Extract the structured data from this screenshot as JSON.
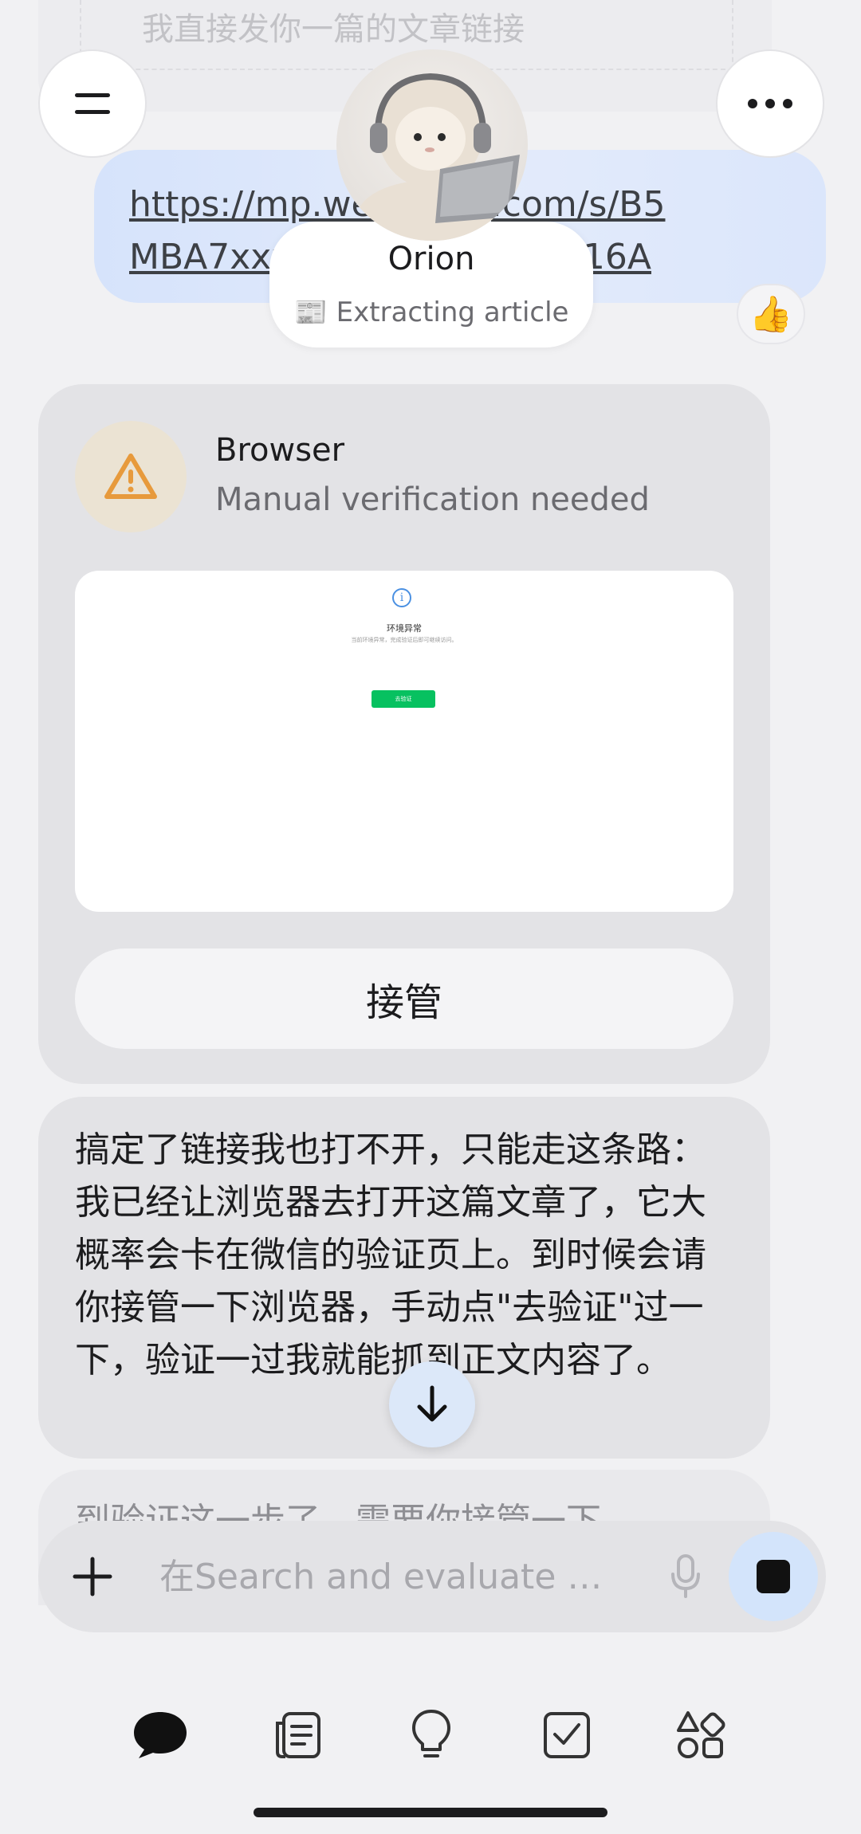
{
  "previous_message": {
    "text": "我直接发你一篇的文章链接"
  },
  "user_link": {
    "text": "https://mp.weixin.qq.com/s/B5MBA7xxxxxxxxxxxxxxxxx16A",
    "reaction": "👍"
  },
  "header": {
    "menu_icon": "menu-icon",
    "more_icon": "more-icon"
  },
  "agent": {
    "name": "Orion",
    "status": "📰 Extracting article"
  },
  "browser_card": {
    "title": "Browser",
    "subtitle": "Manual verification needed",
    "icon": "warning-icon",
    "preview": {
      "title": "环境异常",
      "description": "当前环境异常，完成验证后即可继续访问。",
      "button": "去验证"
    },
    "takeover_label": "接管"
  },
  "assistant_message": {
    "text": "搞定了链接我也打不开，只能走这条路：我已经让浏览器去打开这篇文章了，它大概率会卡在微信的验证页上。到时候会请你接管一下浏览器，手动点\"去验证\"过一下，验证一过我就能抓到正文内容了。"
  },
  "next_message": {
    "text": "到验证这一步了，需要你接管一下"
  },
  "composer": {
    "placeholder": "在Search and evaluate …",
    "add_icon": "plus-icon",
    "mic_icon": "mic-icon",
    "stop_icon": "stop-icon"
  },
  "bottom_nav": [
    {
      "name": "chat",
      "icon": "chat-bubble-icon",
      "active": true
    },
    {
      "name": "notes",
      "icon": "notes-icon",
      "active": false
    },
    {
      "name": "ideas",
      "icon": "lightbulb-icon",
      "active": false
    },
    {
      "name": "tasks",
      "icon": "checkbox-icon",
      "active": false
    },
    {
      "name": "apps",
      "icon": "apps-icon",
      "active": false
    }
  ]
}
